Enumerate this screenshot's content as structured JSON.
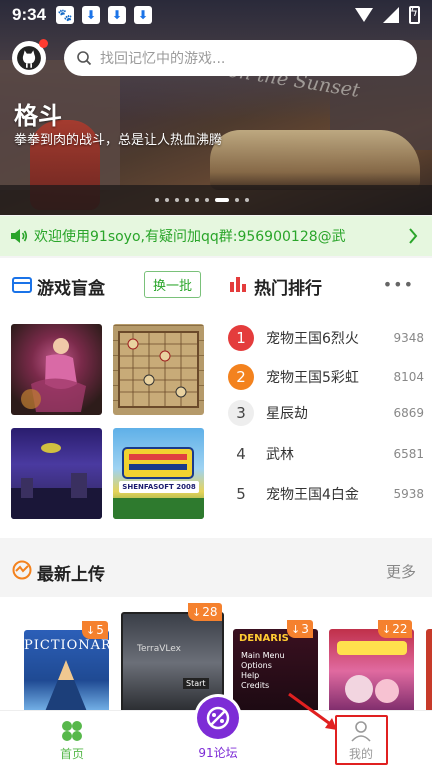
{
  "status_bar": {
    "time": "9:34"
  },
  "search": {
    "placeholder": "找回记忆中的游戏..."
  },
  "hero": {
    "title": "格斗",
    "subtitle": "拳拳到肉的战斗，总是让人热血沸腾",
    "sign_text": "Oldline on the Sunset",
    "active_dot": 6,
    "dot_count": 9
  },
  "notice": {
    "text": "欢迎使用91soyo,有疑问加qq群:956900128@武"
  },
  "blind_box": {
    "title": "游戏盲盒",
    "refresh_label": "换一批",
    "items": [
      {
        "icon": "game-thumb-dancer"
      },
      {
        "icon": "game-thumb-chess"
      },
      {
        "icon": "game-thumb-shooter"
      },
      {
        "icon": "game-thumb-sign",
        "brand": "SHENFASOFT 2008"
      }
    ]
  },
  "hot_rank": {
    "title": "热门排行",
    "more_label": "•••",
    "items": [
      {
        "rank": "1",
        "name": "宠物王国6烈火",
        "count": "9348"
      },
      {
        "rank": "2",
        "name": "宠物王国5彩虹",
        "count": "8104"
      },
      {
        "rank": "3",
        "name": "星辰劫",
        "count": "6869"
      },
      {
        "rank": "4",
        "name": "武林",
        "count": "6581"
      },
      {
        "rank": "5",
        "name": "宠物王国4白金",
        "count": "5938"
      }
    ]
  },
  "latest": {
    "title": "最新上传",
    "more_label": "更多",
    "games": [
      {
        "badge": "5",
        "art_text": "PICTIONARY"
      },
      {
        "badge": "28",
        "art_text": "TerraVLex",
        "start": "Start"
      },
      {
        "badge": "3",
        "art_text": "DENARIS",
        "menu": [
          "Main Menu",
          "Options",
          "Help",
          "Credits"
        ]
      },
      {
        "badge": "22"
      }
    ]
  },
  "bottom_nav": {
    "home_label": "首页",
    "forum_label": "91论坛",
    "mine_label": "我的"
  },
  "colors": {
    "accent_green": "#2aa52a",
    "forum_purple": "#7d2cd6",
    "rank_red": "#e43c3c",
    "rank_orange": "#f3821e",
    "badge_orange": "#f5812e",
    "annotation_red": "#e02020"
  }
}
